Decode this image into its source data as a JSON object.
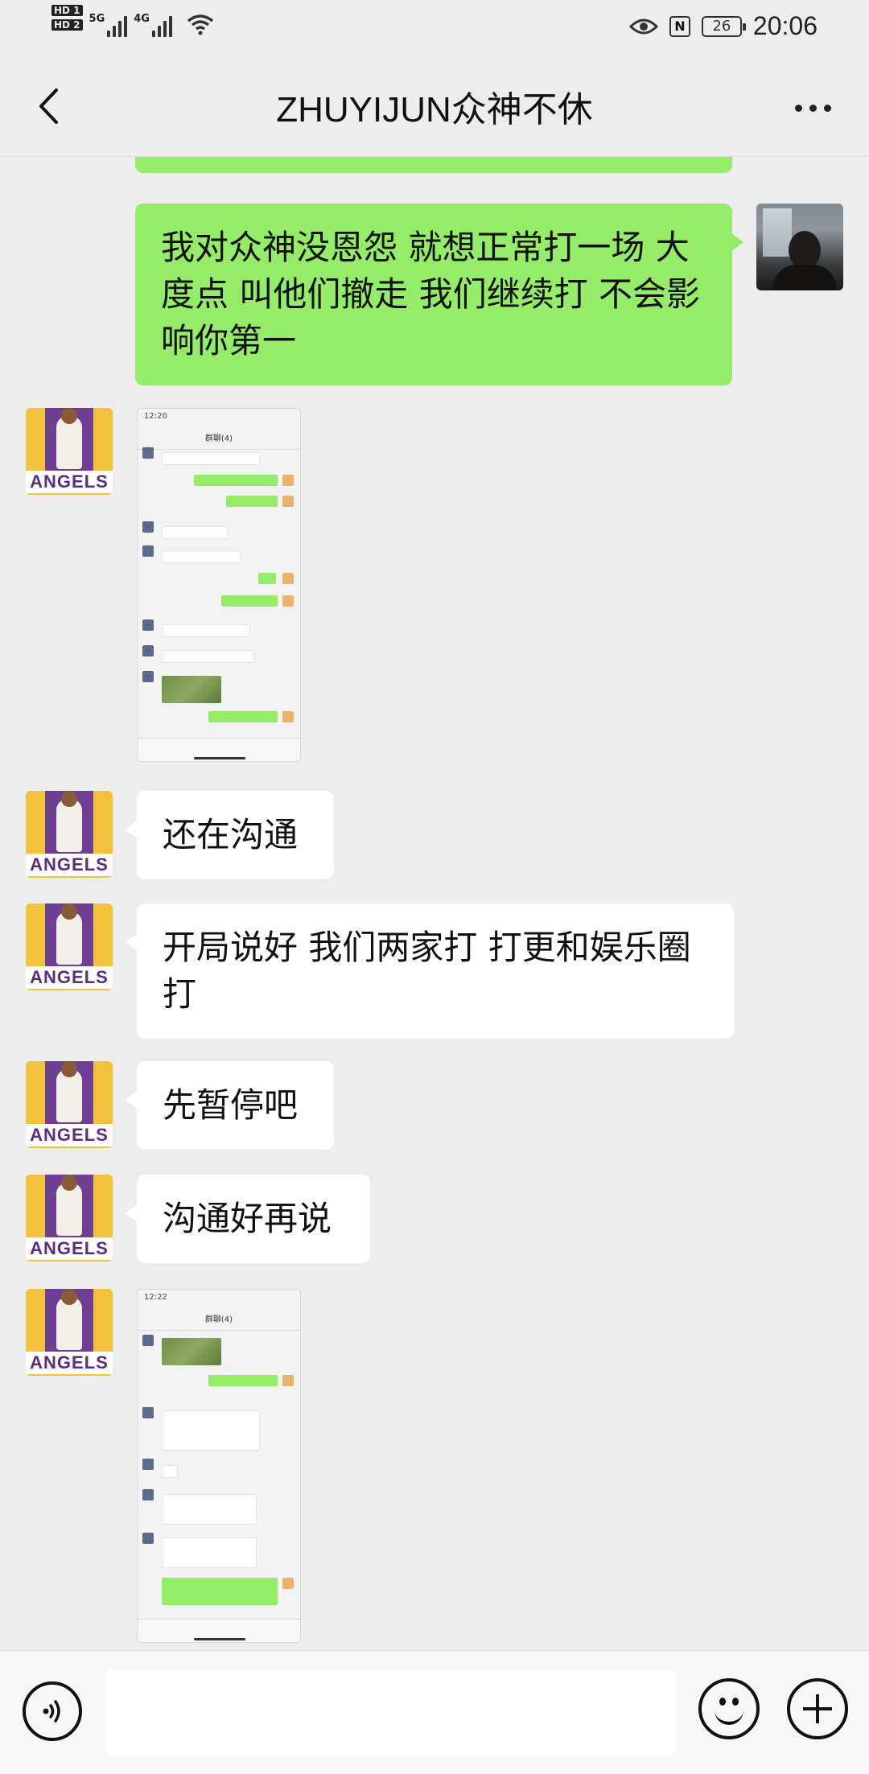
{
  "status_bar": {
    "sim1": "HD 1",
    "sim2": "HD 2",
    "net1": "5G",
    "net2": "4G",
    "battery": "26",
    "time": "20:06",
    "nfc": "N"
  },
  "header": {
    "title": "ZHUYIJUN众神不休"
  },
  "avatar": {
    "angels_text": "ANGELS"
  },
  "messages": [
    {
      "sender": "me",
      "text": "我对众神没恩怨 就想正常打一场 大度点 叫他们撤走 我们继续打 不会影响你第一"
    },
    {
      "sender": "them",
      "type": "image"
    },
    {
      "sender": "them",
      "text": "还在沟通"
    },
    {
      "sender": "them",
      "text": "开局说好 我们两家打 打更和娱乐圈打"
    },
    {
      "sender": "them",
      "text": "先暂停吧"
    },
    {
      "sender": "them",
      "text": "沟通好再说"
    },
    {
      "sender": "them",
      "type": "image"
    }
  ],
  "thumbs": {
    "t1_time": "12:20",
    "t1_title": "群聊(4)",
    "t2_time": "12:22",
    "t2_title": "群聊(4)"
  },
  "input": {
    "value": ""
  },
  "icons": {
    "back": "back-arrow-icon",
    "more": "more-dots-icon",
    "voice": "voice-icon",
    "emoji": "emoji-icon",
    "plus": "plus-icon"
  }
}
